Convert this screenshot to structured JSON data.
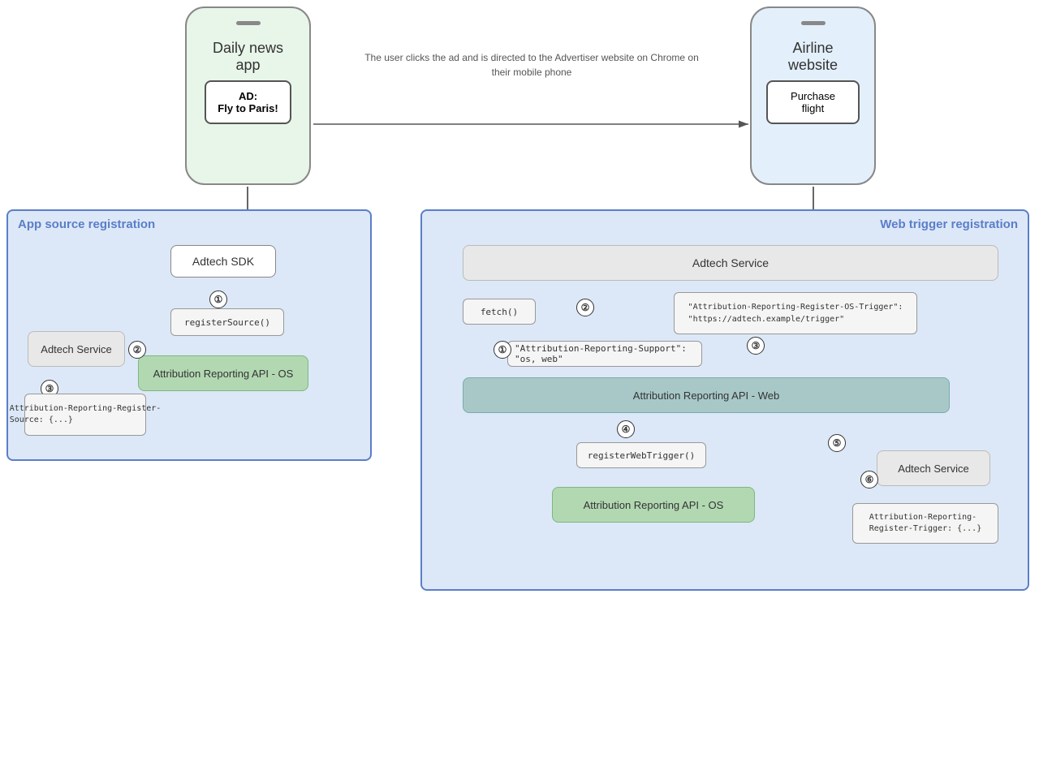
{
  "phones": {
    "left": {
      "title": "Daily news app",
      "ad_label": "AD:",
      "ad_text": "Fly to Paris!"
    },
    "right": {
      "title": "Airline website",
      "button_text": "Purchase flight"
    }
  },
  "arrow_label": "The user clicks the ad and is directed to the Advertiser website on Chrome on their mobile phone",
  "app_reg": {
    "title": "App source registration",
    "adtech_sdk": "Adtech SDK",
    "adtech_service": "Adtech Service",
    "register_source": "registerSource()",
    "attribution_os": "Attribution Reporting API - OS",
    "header_code": "Attribution-Reporting-Register-\nSource: {...}"
  },
  "web_reg": {
    "title": "Web trigger registration",
    "adtech_service_top": "Adtech Service",
    "adtech_service_right": "Adtech Service",
    "fetch": "fetch()",
    "os_trigger_header": "\"Attribution-Reporting-Register-OS-Trigger\":\n\"https://adtech.example/trigger\"",
    "support_header": "\"Attribution-Reporting-Support\": \"os, web\"",
    "attribution_web": "Attribution Reporting API - Web",
    "register_web_trigger": "registerWebTrigger()",
    "attribution_os": "Attribution Reporting API - OS",
    "trigger_header": "Attribution-Reporting-\nRegister-Trigger: {...}"
  },
  "steps": {
    "app_1": "①",
    "app_2": "②",
    "app_3": "③",
    "web_1": "①",
    "web_2": "②",
    "web_3": "③",
    "web_4": "④",
    "web_5": "⑤",
    "web_6": "⑥"
  }
}
